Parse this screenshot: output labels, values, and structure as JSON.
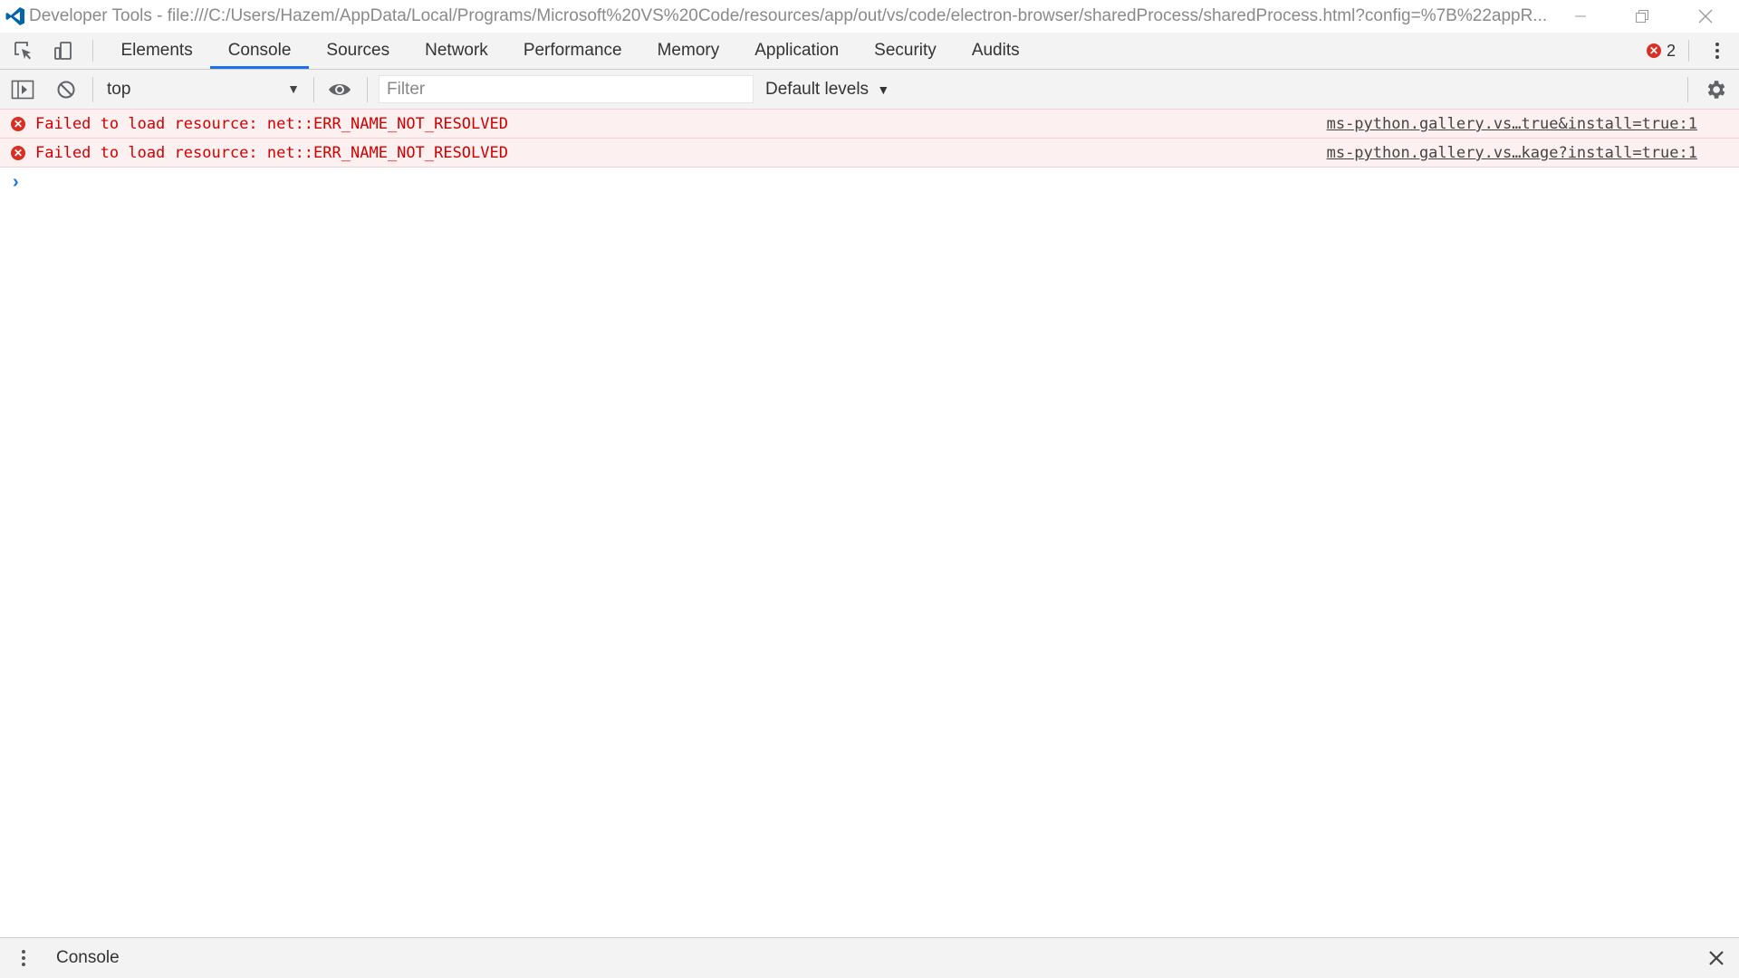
{
  "window": {
    "title": "Developer Tools - file:///C:/Users/Hazem/AppData/Local/Programs/Microsoft%20VS%20Code/resources/app/out/vs/code/electron-browser/sharedProcess/sharedProcess.html?config=%7B%22appR..."
  },
  "tabs": [
    {
      "label": "Elements"
    },
    {
      "label": "Console"
    },
    {
      "label": "Sources"
    },
    {
      "label": "Network"
    },
    {
      "label": "Performance"
    },
    {
      "label": "Memory"
    },
    {
      "label": "Application"
    },
    {
      "label": "Security"
    },
    {
      "label": "Audits"
    }
  ],
  "active_tab": "Console",
  "error_count": "2",
  "toolbar": {
    "context": "top",
    "filter_placeholder": "Filter",
    "filter_value": "",
    "levels": "Default levels"
  },
  "messages": [
    {
      "text": "Failed to load resource: net::ERR_NAME_NOT_RESOLVED",
      "source": "ms-python.gallery.vs…true&install=true:1"
    },
    {
      "text": "Failed to load resource: net::ERR_NAME_NOT_RESOLVED",
      "source": "ms-python.gallery.vs…kage?install=true:1"
    }
  ],
  "drawer": {
    "title": "Console"
  },
  "colors": {
    "accent": "#1a73e8",
    "error": "#d93025",
    "error_bg": "#fdf0f0",
    "vscode_blue": "#0065a9"
  },
  "icons": {
    "app": "vscode-logo-icon",
    "inspect": "inspect-element-icon",
    "device": "device-toolbar-icon",
    "sidebar": "show-sidebar-icon",
    "clear": "clear-console-icon",
    "live_expression": "eye-icon",
    "settings": "gear-icon"
  }
}
